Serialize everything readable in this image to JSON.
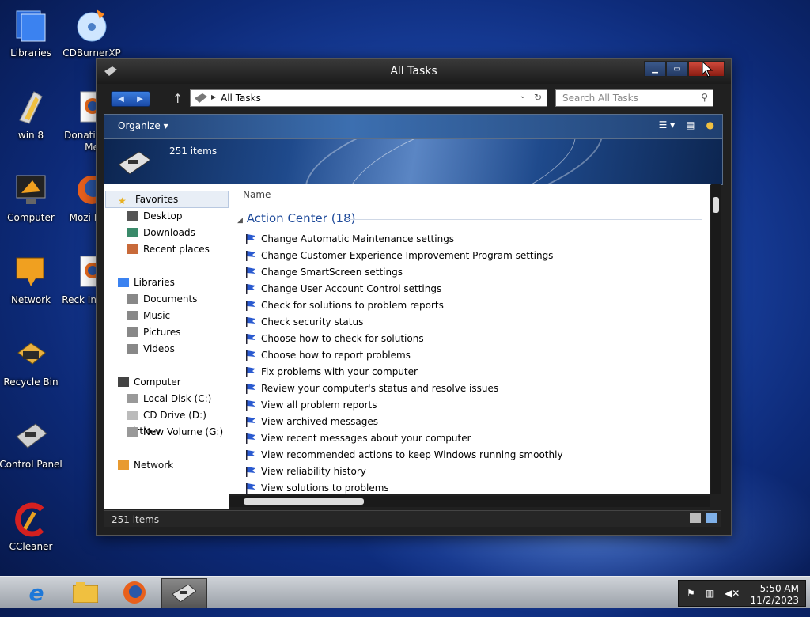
{
  "desktop": {
    "icons": [
      {
        "label": "Libraries"
      },
      {
        "label": "CDBurnerXP"
      },
      {
        "label": "win 8"
      },
      {
        "label": "Donatio VIP Me"
      },
      {
        "label": "Computer"
      },
      {
        "label": "Mozi Firef"
      },
      {
        "label": "Network"
      },
      {
        "label": "Reck Interna"
      },
      {
        "label": "Recycle Bin"
      },
      {
        "label": "Control Panel"
      },
      {
        "label": "CCleaner"
      }
    ]
  },
  "window": {
    "title": "All Tasks",
    "address_path": "All Tasks",
    "search_placeholder": "Search All Tasks",
    "toolbar": {
      "organize": "Organize"
    },
    "banner_count": "251 items",
    "status_count": "251 items"
  },
  "navpane": {
    "favorites": "Favorites",
    "fav_items": [
      "Desktop",
      "Downloads",
      "Recent places"
    ],
    "libraries": "Libraries",
    "lib_items": [
      "Documents",
      "Music",
      "Pictures",
      "Videos"
    ],
    "computer": "Computer",
    "comp_items": [
      "Local Disk (C:)",
      "CD Drive (D:) virtio-v",
      "New Volume (G:)"
    ],
    "network": "Network"
  },
  "content": {
    "column_header": "Name",
    "group_title": "Action Center (18)",
    "tasks": [
      "Change Automatic Maintenance settings",
      "Change Customer Experience Improvement Program settings",
      "Change SmartScreen settings",
      "Change User Account Control settings",
      "Check for solutions to problem reports",
      "Check security status",
      "Choose how to check for solutions",
      "Choose how to report problems",
      "Fix problems with your computer",
      "Review your computer's status and resolve issues",
      "View all problem reports",
      "View archived messages",
      "View recent messages about your computer",
      "View recommended actions to keep Windows running smoothly",
      "View reliability history",
      "View solutions to problems"
    ]
  },
  "taskbar": {
    "time": "5:50 AM",
    "date": "11/2/2023"
  }
}
